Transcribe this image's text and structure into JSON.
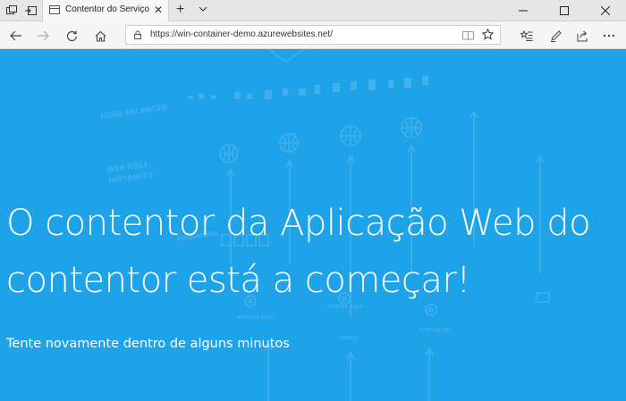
{
  "browser": {
    "tab": {
      "title": "Contentor do Serviço",
      "close_icon": "close-icon"
    },
    "tabbar_icons": [
      "tab-set-aside-icon",
      "tab-preview-icon",
      "new-tab-icon",
      "tab-list-chevron-icon"
    ],
    "window_controls": [
      "minimize-icon",
      "maximize-icon",
      "close-icon"
    ],
    "address_bar": {
      "url": "https://win-container-demo.azurewebsites.net/"
    },
    "nav_icons": [
      "back-icon",
      "forward-icon",
      "refresh-icon",
      "home-icon"
    ],
    "toolbar_icons": [
      "reading-view-icon",
      "favorite-star-icon",
      "favorites-hub-icon",
      "pen-icon",
      "share-icon",
      "more-icon"
    ]
  },
  "page": {
    "headline": "O contentor da Aplicação Web do contentor está a começar!",
    "subtext": "Tente novamente dentro de alguns minutos",
    "background_color": "#1fa3e8",
    "background_art_labels": [
      "LOAD BALANCER",
      "WEB ROLE",
      "INSTANCES",
      "MESSAGING",
      "WORKER ROLE",
      "WORKER ROLE",
      "TOPICS",
      "TYPE CACHE"
    ]
  }
}
